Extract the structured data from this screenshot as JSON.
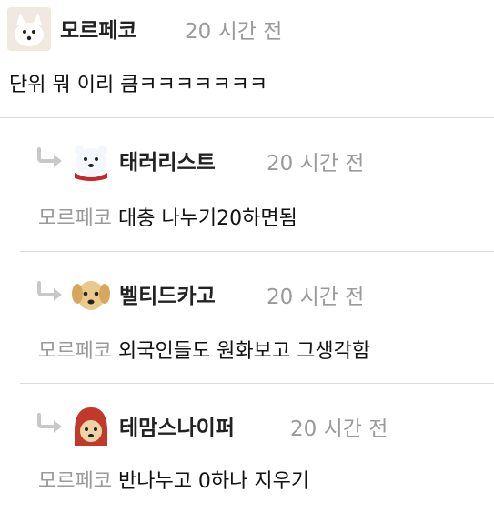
{
  "post": {
    "author": "모르페코",
    "time": "20 시간 전",
    "text": "단위 뭐 이리 큼ㅋㅋㅋㅋㅋㅋㅋ"
  },
  "replies": [
    {
      "author": "태러리스트",
      "time": "20 시간 전",
      "mention": "모르페코",
      "text": "대충 나누기20하면됨"
    },
    {
      "author": "벨티드카고",
      "time": "20 시간 전",
      "mention": "모르페코",
      "text": "외국인들도 원화보고 그생각함"
    },
    {
      "author": "테맘스나이퍼",
      "time": "20 시간 전",
      "mention": "모르페코",
      "text": "반나누고 0하나 지우기"
    }
  ],
  "colors": {
    "muted": "#9a9a9a",
    "divider": "#dcdcdc",
    "arrow": "#c8c8c8"
  }
}
